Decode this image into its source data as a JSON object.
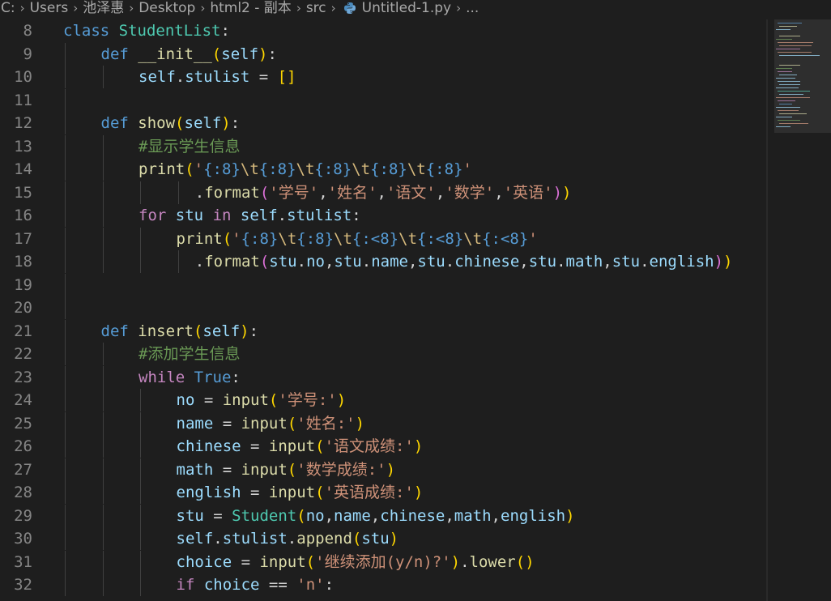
{
  "breadcrumb": {
    "items": [
      "C:",
      "Users",
      "池泽惠",
      "Desktop",
      "html2 - 副本",
      "src",
      "Untitled-1.py",
      "..."
    ],
    "separator": "›"
  },
  "colors": {
    "background": "#1e1e1e",
    "keyword": "#569cd6",
    "control_flow": "#c586c0",
    "class_name": "#4ec9b0",
    "function": "#dcdcaa",
    "variable": "#9cdcfe",
    "string": "#ce9178",
    "comment": "#6a9955",
    "line_number": "#858585"
  },
  "editor": {
    "language": "python",
    "file": "Untitled-1.py",
    "lines": [
      {
        "n": "8",
        "indent": 0,
        "tokens": [
          [
            "kw",
            "class"
          ],
          [
            "op",
            " "
          ],
          [
            "cls",
            "StudentList"
          ],
          [
            "op",
            ":"
          ]
        ]
      },
      {
        "n": "9",
        "indent": 1,
        "tokens": [
          [
            "kw",
            "def"
          ],
          [
            "op",
            " "
          ],
          [
            "fn",
            "__init__"
          ],
          [
            "p1",
            "("
          ],
          [
            "var",
            "self"
          ],
          [
            "p1",
            ")"
          ],
          [
            "op",
            ":"
          ]
        ]
      },
      {
        "n": "10",
        "indent": 2,
        "tokens": [
          [
            "var",
            "self"
          ],
          [
            "op",
            "."
          ],
          [
            "var",
            "stulist"
          ],
          [
            "op",
            " = "
          ],
          [
            "p1",
            "[]"
          ]
        ]
      },
      {
        "n": "11",
        "indent": 0,
        "tokens": []
      },
      {
        "n": "12",
        "indent": 1,
        "tokens": [
          [
            "kw",
            "def"
          ],
          [
            "op",
            " "
          ],
          [
            "fn",
            "show"
          ],
          [
            "p1",
            "("
          ],
          [
            "var",
            "self"
          ],
          [
            "p1",
            ")"
          ],
          [
            "op",
            ":"
          ]
        ]
      },
      {
        "n": "13",
        "indent": 2,
        "tokens": [
          [
            "cmt",
            "#显示学生信息"
          ]
        ]
      },
      {
        "n": "14",
        "indent": 2,
        "tokens": [
          [
            "fn",
            "print"
          ],
          [
            "p1",
            "("
          ],
          [
            "str",
            "'"
          ],
          [
            "fmt",
            "{:8}"
          ],
          [
            "esc",
            "\\t"
          ],
          [
            "fmt",
            "{:8}"
          ],
          [
            "esc",
            "\\t"
          ],
          [
            "fmt",
            "{:8}"
          ],
          [
            "esc",
            "\\t"
          ],
          [
            "fmt",
            "{:8}"
          ],
          [
            "esc",
            "\\t"
          ],
          [
            "fmt",
            "{:8}"
          ],
          [
            "str",
            "'"
          ]
        ]
      },
      {
        "n": "15",
        "indent": 3.5,
        "tokens": [
          [
            "op",
            "."
          ],
          [
            "fn",
            "format"
          ],
          [
            "p2",
            "("
          ],
          [
            "str",
            "'学号'"
          ],
          [
            "op",
            ","
          ],
          [
            "str",
            "'姓名'"
          ],
          [
            "op",
            ","
          ],
          [
            "str",
            "'语文'"
          ],
          [
            "op",
            ","
          ],
          [
            "str",
            "'数学'"
          ],
          [
            "op",
            ","
          ],
          [
            "str",
            "'英语'"
          ],
          [
            "p2",
            ")"
          ],
          [
            "p1",
            ")"
          ]
        ]
      },
      {
        "n": "16",
        "indent": 2,
        "tokens": [
          [
            "flow",
            "for"
          ],
          [
            "op",
            " "
          ],
          [
            "var",
            "stu"
          ],
          [
            "op",
            " "
          ],
          [
            "flow",
            "in"
          ],
          [
            "op",
            " "
          ],
          [
            "var",
            "self"
          ],
          [
            "op",
            "."
          ],
          [
            "var",
            "stulist"
          ],
          [
            "op",
            ":"
          ]
        ]
      },
      {
        "n": "17",
        "indent": 3,
        "tokens": [
          [
            "fn",
            "print"
          ],
          [
            "p1",
            "("
          ],
          [
            "str",
            "'"
          ],
          [
            "fmt",
            "{:8}"
          ],
          [
            "esc",
            "\\t"
          ],
          [
            "fmt",
            "{:8}"
          ],
          [
            "esc",
            "\\t"
          ],
          [
            "fmt",
            "{:<8}"
          ],
          [
            "esc",
            "\\t"
          ],
          [
            "fmt",
            "{:<8}"
          ],
          [
            "esc",
            "\\t"
          ],
          [
            "fmt",
            "{:<8}"
          ],
          [
            "str",
            "'"
          ]
        ]
      },
      {
        "n": "18",
        "indent": 3.5,
        "tokens": [
          [
            "op",
            "."
          ],
          [
            "fn",
            "format"
          ],
          [
            "p2",
            "("
          ],
          [
            "var",
            "stu"
          ],
          [
            "op",
            "."
          ],
          [
            "var",
            "no"
          ],
          [
            "op",
            ","
          ],
          [
            "var",
            "stu"
          ],
          [
            "op",
            "."
          ],
          [
            "var",
            "name"
          ],
          [
            "op",
            ","
          ],
          [
            "var",
            "stu"
          ],
          [
            "op",
            "."
          ],
          [
            "var",
            "chinese"
          ],
          [
            "op",
            ","
          ],
          [
            "var",
            "stu"
          ],
          [
            "op",
            "."
          ],
          [
            "var",
            "math"
          ],
          [
            "op",
            ","
          ],
          [
            "var",
            "stu"
          ],
          [
            "op",
            "."
          ],
          [
            "var",
            "english"
          ],
          [
            "p2",
            ")"
          ],
          [
            "p1",
            ")"
          ]
        ]
      },
      {
        "n": "19",
        "indent": 0,
        "tokens": []
      },
      {
        "n": "20",
        "indent": 0,
        "tokens": []
      },
      {
        "n": "21",
        "indent": 1,
        "tokens": [
          [
            "kw",
            "def"
          ],
          [
            "op",
            " "
          ],
          [
            "fn",
            "insert"
          ],
          [
            "p1",
            "("
          ],
          [
            "var",
            "self"
          ],
          [
            "p1",
            ")"
          ],
          [
            "op",
            ":"
          ]
        ]
      },
      {
        "n": "22",
        "indent": 2,
        "tokens": [
          [
            "cmt",
            "#添加学生信息"
          ]
        ]
      },
      {
        "n": "23",
        "indent": 2,
        "tokens": [
          [
            "flow",
            "while"
          ],
          [
            "op",
            " "
          ],
          [
            "kw",
            "True"
          ],
          [
            "op",
            ":"
          ]
        ]
      },
      {
        "n": "24",
        "indent": 3,
        "tokens": [
          [
            "var",
            "no"
          ],
          [
            "op",
            " = "
          ],
          [
            "fn",
            "input"
          ],
          [
            "p1",
            "("
          ],
          [
            "str",
            "'学号:'"
          ],
          [
            "p1",
            ")"
          ]
        ]
      },
      {
        "n": "25",
        "indent": 3,
        "tokens": [
          [
            "var",
            "name"
          ],
          [
            "op",
            " = "
          ],
          [
            "fn",
            "input"
          ],
          [
            "p1",
            "("
          ],
          [
            "str",
            "'姓名:'"
          ],
          [
            "p1",
            ")"
          ]
        ]
      },
      {
        "n": "26",
        "indent": 3,
        "tokens": [
          [
            "var",
            "chinese"
          ],
          [
            "op",
            " = "
          ],
          [
            "fn",
            "input"
          ],
          [
            "p1",
            "("
          ],
          [
            "str",
            "'语文成绩:'"
          ],
          [
            "p1",
            ")"
          ]
        ]
      },
      {
        "n": "27",
        "indent": 3,
        "tokens": [
          [
            "var",
            "math"
          ],
          [
            "op",
            " = "
          ],
          [
            "fn",
            "input"
          ],
          [
            "p1",
            "("
          ],
          [
            "str",
            "'数学成绩:'"
          ],
          [
            "p1",
            ")"
          ]
        ]
      },
      {
        "n": "28",
        "indent": 3,
        "tokens": [
          [
            "var",
            "english"
          ],
          [
            "op",
            " = "
          ],
          [
            "fn",
            "input"
          ],
          [
            "p1",
            "("
          ],
          [
            "str",
            "'英语成绩:'"
          ],
          [
            "p1",
            ")"
          ]
        ]
      },
      {
        "n": "29",
        "indent": 3,
        "tokens": [
          [
            "var",
            "stu"
          ],
          [
            "op",
            " = "
          ],
          [
            "cls",
            "Student"
          ],
          [
            "p1",
            "("
          ],
          [
            "var",
            "no"
          ],
          [
            "op",
            ","
          ],
          [
            "var",
            "name"
          ],
          [
            "op",
            ","
          ],
          [
            "var",
            "chinese"
          ],
          [
            "op",
            ","
          ],
          [
            "var",
            "math"
          ],
          [
            "op",
            ","
          ],
          [
            "var",
            "english"
          ],
          [
            "p1",
            ")"
          ]
        ]
      },
      {
        "n": "30",
        "indent": 3,
        "tokens": [
          [
            "var",
            "self"
          ],
          [
            "op",
            "."
          ],
          [
            "var",
            "stulist"
          ],
          [
            "op",
            "."
          ],
          [
            "fn",
            "append"
          ],
          [
            "p1",
            "("
          ],
          [
            "var",
            "stu"
          ],
          [
            "p1",
            ")"
          ]
        ]
      },
      {
        "n": "31",
        "indent": 3,
        "tokens": [
          [
            "var",
            "choice"
          ],
          [
            "op",
            " = "
          ],
          [
            "fn",
            "input"
          ],
          [
            "p1",
            "("
          ],
          [
            "str",
            "'继续添加(y/n)?'"
          ],
          [
            "p1",
            ")"
          ],
          [
            "op",
            "."
          ],
          [
            "fn",
            "lower"
          ],
          [
            "p1",
            "()"
          ]
        ]
      },
      {
        "n": "32",
        "indent": 3,
        "tokens": [
          [
            "flow",
            "if"
          ],
          [
            "op",
            " "
          ],
          [
            "var",
            "choice"
          ],
          [
            "op",
            " == "
          ],
          [
            "str",
            "'n'"
          ],
          [
            "op",
            ":"
          ]
        ]
      }
    ]
  }
}
